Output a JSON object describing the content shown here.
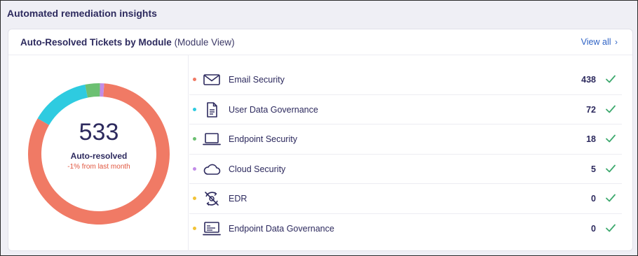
{
  "page": {
    "title": "Automated remediation insights"
  },
  "card": {
    "title": "Auto-Resolved Tickets by Module",
    "subtitle": "(Module View)",
    "view_all_label": "View all",
    "view_all_chevron": "›"
  },
  "summary": {
    "total": "533",
    "caption": "Auto-resolved",
    "trend": "-1% from last month"
  },
  "modules": [
    {
      "name": "Email Security",
      "count": "438",
      "color": "#f07a65",
      "icon": "envelope-icon"
    },
    {
      "name": "User Data Governance",
      "count": "72",
      "color": "#2ecbe0",
      "icon": "document-icon"
    },
    {
      "name": "Endpoint Security",
      "count": "18",
      "color": "#6cc072",
      "icon": "laptop-icon"
    },
    {
      "name": "Cloud Security",
      "count": "5",
      "color": "#c28ce8",
      "icon": "cloud-icon"
    },
    {
      "name": "EDR",
      "count": "0",
      "color": "#f2c337",
      "icon": "edr-icon"
    },
    {
      "name": "Endpoint Data Governance",
      "count": "0",
      "color": "#f2c337",
      "icon": "monitor-icon"
    }
  ],
  "chart_data": {
    "type": "pie",
    "variant": "donut",
    "categories": [
      "Email Security",
      "User Data Governance",
      "Endpoint Security",
      "Cloud Security",
      "EDR",
      "Endpoint Data Governance"
    ],
    "values": [
      438,
      72,
      18,
      5,
      0,
      0
    ],
    "colors": [
      "#f07a65",
      "#2ecbe0",
      "#6cc072",
      "#c28ce8",
      "#f2c337",
      "#f2c337"
    ]
  }
}
